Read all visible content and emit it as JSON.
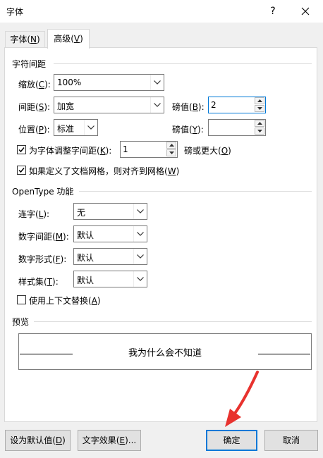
{
  "window": {
    "title": "字体",
    "help_icon": "question-mark",
    "close_icon": "x"
  },
  "tabs": [
    {
      "label": "字体(",
      "key": "N",
      "suffix": ")",
      "active": false
    },
    {
      "label": "高级(",
      "key": "V",
      "suffix": ")",
      "active": true
    }
  ],
  "spacing_group": {
    "title": "字符间距",
    "scale": {
      "label": "缩放(",
      "key": "C",
      "suffix": "):",
      "value": "100%"
    },
    "spacing": {
      "label": "间距(",
      "key": "S",
      "suffix": "):",
      "value": "加宽"
    },
    "spacing_pts": {
      "label": "磅值(",
      "key": "B",
      "suffix": "):",
      "value": "2"
    },
    "position": {
      "label": "位置(",
      "key": "P",
      "suffix": "):",
      "value": "标准"
    },
    "position_pts": {
      "label": "磅值(",
      "key": "Y",
      "suffix": "):",
      "value": ""
    },
    "kerning": {
      "checked": true,
      "label": "为字体调整字间距(",
      "key": "K",
      "suffix": "):",
      "value": "1",
      "after": "磅或更大(",
      "after_key": "O",
      "after_suffix": ")"
    },
    "snap_grid": {
      "checked": true,
      "label": "如果定义了文档网格，则对齐到网格(",
      "key": "W",
      "suffix": ")"
    }
  },
  "opentype_group": {
    "title": "OpenType 功能",
    "ligatures": {
      "label": "连字(",
      "key": "L",
      "suffix": "):",
      "value": "无"
    },
    "number_spacing": {
      "label": "数字间距(",
      "key": "M",
      "suffix": "):",
      "value": "默认"
    },
    "number_forms": {
      "label": "数字形式(",
      "key": "F",
      "suffix": "):",
      "value": "默认"
    },
    "stylistic_sets": {
      "label": "样式集(",
      "key": "T",
      "suffix": "):",
      "value": "默认"
    },
    "contextual": {
      "checked": false,
      "label": "使用上下文替换(",
      "key": "A",
      "suffix": ")"
    }
  },
  "preview": {
    "title": "预览",
    "text": "我为什么会不知道"
  },
  "buttons": {
    "set_default": {
      "label": "设为默认值(",
      "key": "D",
      "suffix": ")"
    },
    "text_effects": {
      "label": "文字效果(",
      "key": "E",
      "suffix": ")..."
    },
    "ok": "确定",
    "cancel": "取消"
  },
  "colors": {
    "accent": "#0078d7",
    "annotation_arrow": "#e8322e",
    "panel": "#ffffff",
    "chrome": "#f0f0f0"
  }
}
